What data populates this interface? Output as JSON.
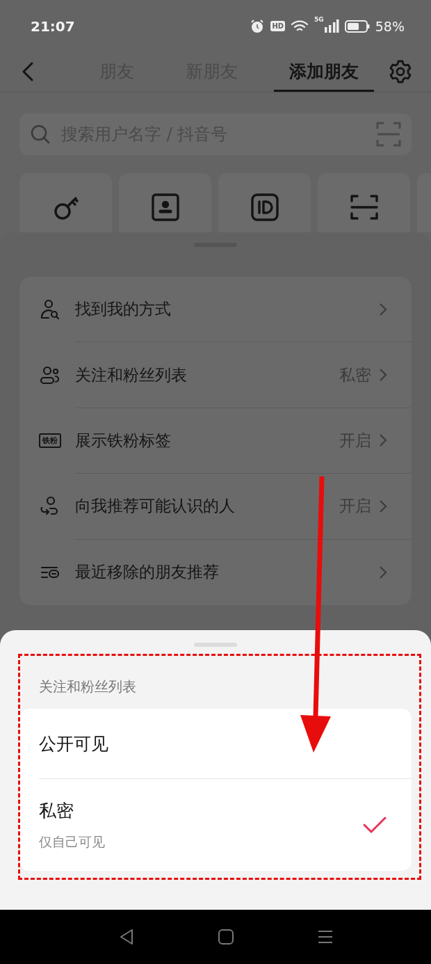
{
  "status_bar": {
    "time": "21:07",
    "hd_badge": "HD",
    "network": "5G",
    "battery_text": "58%"
  },
  "header": {
    "tabs": [
      {
        "label": "朋友",
        "selected": false
      },
      {
        "label": "新朋友",
        "selected": false
      },
      {
        "label": "添加朋友",
        "selected": true
      }
    ]
  },
  "search": {
    "placeholder": "搜索用户名字 / 抖音号"
  },
  "quick_actions": [
    {
      "kind": "key"
    },
    {
      "kind": "contact"
    },
    {
      "kind": "id"
    },
    {
      "kind": "scan"
    },
    {
      "kind": "more"
    }
  ],
  "settings": [
    {
      "kind": "find",
      "label": "找到我的方式"
    },
    {
      "kind": "follow",
      "label": "关注和粉丝列表",
      "value": "私密"
    },
    {
      "kind": "badge",
      "badge_text": "铁粉",
      "label": "展示铁粉标签",
      "value": "开启"
    },
    {
      "kind": "recommend",
      "label": "向我推荐可能认识的人",
      "value": "开启"
    },
    {
      "kind": "removed",
      "label": "最近移除的朋友推荐"
    }
  ],
  "sheet": {
    "title": "关注和粉丝列表",
    "options": [
      {
        "label": "公开可见",
        "selected": false
      },
      {
        "label": "私密",
        "note": "仅自己可见",
        "selected": true
      }
    ]
  }
}
